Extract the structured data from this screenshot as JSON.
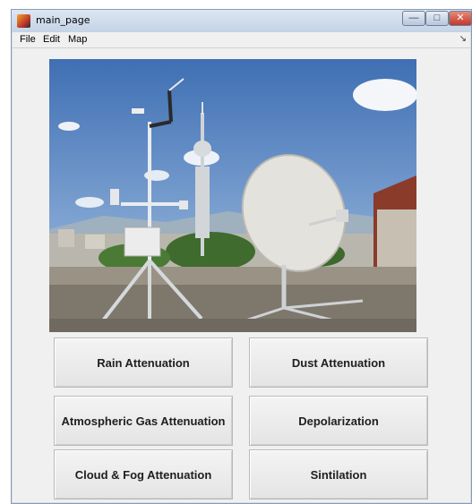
{
  "window": {
    "title": "main_page",
    "controls": {
      "minimize": "—",
      "maximize": "□",
      "close": "✕"
    }
  },
  "menu": {
    "items": [
      "File",
      "Edit",
      "Map"
    ],
    "overflow_arrow": "↘"
  },
  "buttons": [
    {
      "label": "Rain Attenuation"
    },
    {
      "label": "Dust Attenuation"
    },
    {
      "label": "Atmospheric Gas Attenuation"
    },
    {
      "label": "Depolarization"
    },
    {
      "label": "Cloud & Fog Attenuation"
    },
    {
      "label": "Sintilation"
    }
  ],
  "colors": {
    "sky": "#5d87c0",
    "button_face": "#ececec",
    "window_frame": "#c4d3e6"
  }
}
